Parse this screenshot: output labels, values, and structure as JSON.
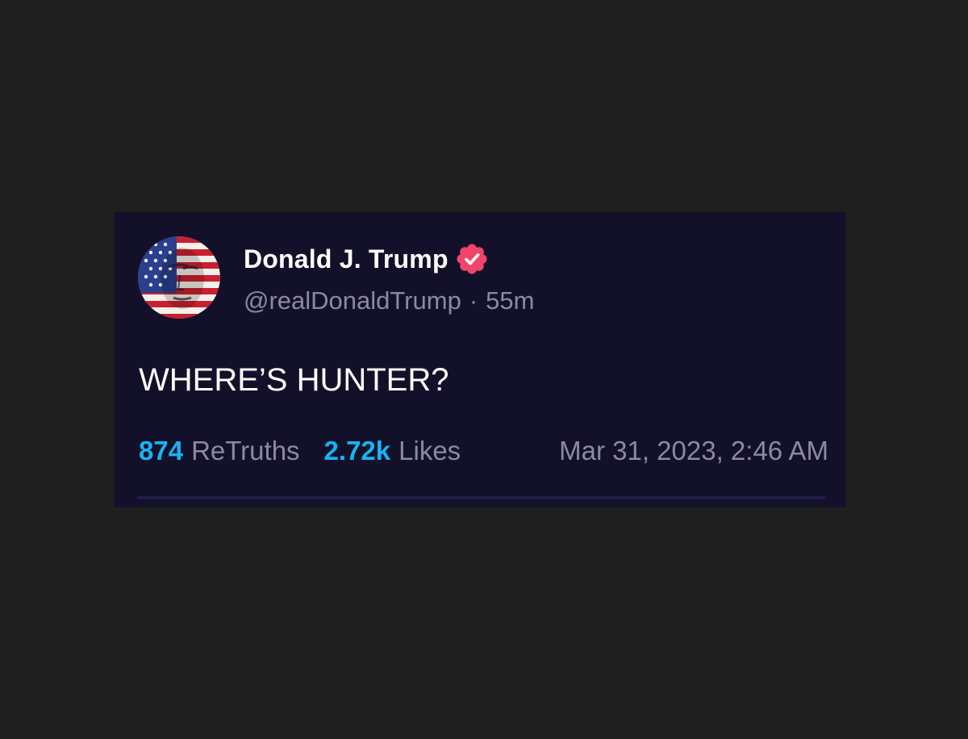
{
  "post": {
    "author": {
      "display_name": "Donald J. Trump",
      "handle": "@realDonaldTrump",
      "verified": true,
      "avatar_icon": "american-flag-portrait-avatar"
    },
    "separator": "·",
    "time_ago": "55m",
    "text": "WHERE’S HUNTER?",
    "stats": {
      "retruths_count": "874",
      "retruths_label": "ReTruths",
      "likes_count": "2.72k",
      "likes_label": "Likes"
    },
    "timestamp": "Mar 31, 2023, 2:46 AM"
  },
  "colors": {
    "page_background": "#1f1f1f",
    "card_background": "#13112a",
    "accent": "#17b3f2",
    "verified_badge": "#f2446b",
    "muted_text": "#8c8a9e",
    "divider": "#1e1d4d"
  }
}
